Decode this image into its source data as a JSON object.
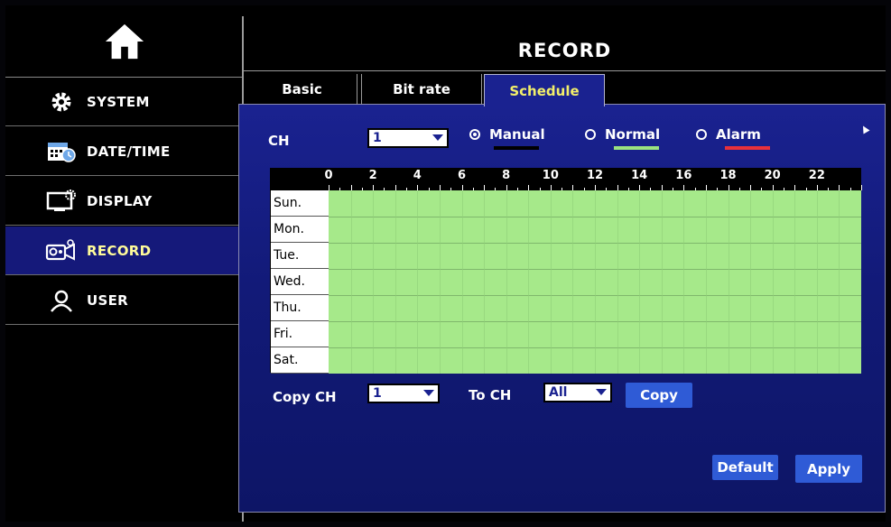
{
  "sidebar": {
    "home_icon": "home-icon",
    "items": [
      {
        "label": "SYSTEM",
        "icon": "gear-icon"
      },
      {
        "label": "DATE/TIME",
        "icon": "calendar-icon"
      },
      {
        "label": "DISPLAY",
        "icon": "monitor-icon"
      },
      {
        "label": "RECORD",
        "icon": "camera-icon",
        "active": true
      },
      {
        "label": "USER",
        "icon": "user-icon"
      }
    ]
  },
  "header": {
    "title": "RECORD"
  },
  "tabs": [
    {
      "label": "Basic"
    },
    {
      "label": "Bit rate"
    },
    {
      "label": "Schedule",
      "active": true
    }
  ],
  "schedule": {
    "ch_label": "CH",
    "ch_value": "1",
    "modes": [
      {
        "label": "Manual",
        "selected": true,
        "color": "#000000"
      },
      {
        "label": "Normal",
        "selected": false,
        "color": "#9be27f"
      },
      {
        "label": "Alarm",
        "selected": false,
        "color": "#e8313a"
      }
    ],
    "hours": [
      "0",
      "2",
      "4",
      "6",
      "8",
      "10",
      "12",
      "14",
      "16",
      "18",
      "20",
      "22"
    ],
    "days": [
      "Sun.",
      "Mon.",
      "Tue.",
      "Wed.",
      "Thu.",
      "Fri.",
      "Sat."
    ],
    "fill_mode": "Normal",
    "fill_color": "#a6e98a"
  },
  "copy": {
    "copy_ch_label": "Copy CH",
    "copy_ch_value": "1",
    "to_ch_label": "To CH",
    "to_ch_value": "All",
    "copy_button": "Copy"
  },
  "footer": {
    "default_button": "Default",
    "apply_button": "Apply"
  },
  "colors": {
    "panel": "#1a2290",
    "active_sidebar": "#15197a",
    "button": "#2f5bd6",
    "active_text": "#fffc9a",
    "tab_active_text": "#f2ef6a"
  }
}
